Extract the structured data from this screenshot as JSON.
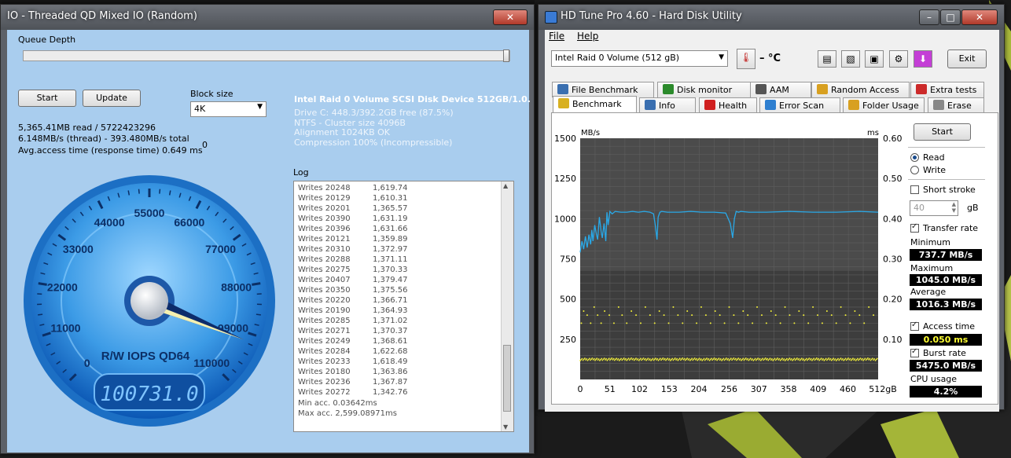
{
  "io": {
    "title": "IO - Threaded QD Mixed IO (Random)",
    "queue_depth_label": "Queue Depth",
    "start_label": "Start",
    "update_label": "Update",
    "block_size_label": "Block size",
    "block_size_value": "4K",
    "stat_line1": "5,365.41MB read / 5722423296",
    "stat_line2": "6.148MB/s (thread) - 393.480MB/s total",
    "stat_line3": "Avg.access time (response time) 0.649 ms",
    "zero_value": "0",
    "disk_title": "Intel Raid 0 Volume SCSI Disk Device 512GB/1.0.",
    "disk_info": [
      "Drive C: 448.3/392.2GB free (87.5%)",
      "NTFS - Cluster size 4096B",
      "Alignment 1024KB OK",
      "Compression 100% (Incompressible)"
    ],
    "log_label": "Log",
    "log_rows": [
      {
        "name": "Writes 20248",
        "value": "1,619.74"
      },
      {
        "name": "Writes 20129",
        "value": "1,610.31"
      },
      {
        "name": "Writes 20201",
        "value": "1,365.57"
      },
      {
        "name": "Writes 20390",
        "value": "1,631.19"
      },
      {
        "name": "Writes 20396",
        "value": "1,631.66"
      },
      {
        "name": "Writes 20121",
        "value": "1,359.89"
      },
      {
        "name": "Writes 20310",
        "value": "1,372.97"
      },
      {
        "name": "Writes 20288",
        "value": "1,371.11"
      },
      {
        "name": "Writes 20275",
        "value": "1,370.33"
      },
      {
        "name": "Writes 20407",
        "value": "1,379.47"
      },
      {
        "name": "Writes 20350",
        "value": "1,375.56"
      },
      {
        "name": "Writes 20220",
        "value": "1,366.71"
      },
      {
        "name": "Writes 20190",
        "value": "1,364.93"
      },
      {
        "name": "Writes 20285",
        "value": "1,371.02"
      },
      {
        "name": "Writes 20271",
        "value": "1,370.37"
      },
      {
        "name": "Writes 20249",
        "value": "1,368.61"
      },
      {
        "name": "Writes 20284",
        "value": "1,622.68"
      },
      {
        "name": "Writes 20233",
        "value": "1,618.49"
      },
      {
        "name": "Writes 20180",
        "value": "1,363.86"
      },
      {
        "name": "Writes 20236",
        "value": "1,367.87"
      },
      {
        "name": "Writes 20272",
        "value": "1,342.76"
      }
    ],
    "log_min": "Min acc. 0.03642ms",
    "log_max": "Max acc. 2,599.08971ms",
    "gauge_label": "R/W IOPS QD64",
    "gauge_value": "100731.0",
    "gauge_ticks": [
      "0",
      "11000",
      "22000",
      "33000",
      "44000",
      "55000",
      "66000",
      "77000",
      "88000",
      "99000",
      "110000"
    ],
    "gauge_fraction": 0.916
  },
  "hd": {
    "title": "HD Tune Pro 4.60 - Hard Disk Utility",
    "menu": [
      "File",
      "Help"
    ],
    "drive": "Intel   Raid 0 Volume (512 gB)",
    "temp": "– °C",
    "exit_label": "Exit",
    "tabs_row1": [
      "File Benchmark",
      "Disk monitor",
      "AAM",
      "Random Access",
      "Extra tests"
    ],
    "tabs_row2": [
      "Benchmark",
      "Info",
      "Health",
      "Error Scan",
      "Folder Usage",
      "Erase"
    ],
    "start_label": "Start",
    "read_label": "Read",
    "write_label": "Write",
    "short_stroke_label": "Short stroke",
    "short_stroke_value": "40",
    "gb_label": "gB",
    "transfer_rate_label": "Transfer rate",
    "minimum_label": "Minimum",
    "minimum_value": "737.7 MB/s",
    "maximum_label": "Maximum",
    "maximum_value": "1045.0 MB/s",
    "average_label": "Average",
    "average_value": "1016.3 MB/s",
    "access_time_label": "Access time",
    "access_time_value": "0.050 ms",
    "burst_rate_label": "Burst rate",
    "burst_rate_value": "5475.0 MB/s",
    "cpu_label": "CPU usage",
    "cpu_value": "4.2%"
  },
  "colors": {
    "gauge_blue": "#1e73c8",
    "line_blue": "#29a9e8",
    "scatter_yellow": "#f2ef3a",
    "lcd_text": "#ffffff"
  },
  "chart_data": {
    "type": "line",
    "ylabel": "MB/s",
    "y2label": "ms",
    "ylim": [
      0,
      1500
    ],
    "y2lim": [
      0,
      0.6
    ],
    "yticks": [
      "250",
      "500",
      "750",
      "1000",
      "1250",
      "1500"
    ],
    "y2ticks": [
      "0.10",
      "0.20",
      "0.30",
      "0.40",
      "0.50",
      "0.60"
    ],
    "xticks": [
      "0",
      "51",
      "102",
      "153",
      "204",
      "256",
      "307",
      "358",
      "409",
      "460",
      "512gB"
    ],
    "xlim": [
      0,
      512
    ],
    "series": [
      {
        "values_x": [
          0,
          3,
          6,
          9,
          12,
          15,
          18,
          20,
          22,
          25,
          28,
          30,
          33,
          36,
          38,
          41,
          44,
          46,
          48,
          51,
          55,
          60,
          70,
          80,
          90,
          100,
          110,
          120,
          126,
          129,
          132,
          134,
          137,
          140,
          150,
          170,
          190,
          210,
          230,
          250,
          258,
          262,
          265,
          268,
          272,
          276,
          290,
          320,
          360,
          400,
          440,
          480,
          512
        ],
        "values_y": [
          790,
          860,
          810,
          890,
          820,
          900,
          840,
          930,
          860,
          960,
          900,
          870,
          1010,
          920,
          880,
          970,
          860,
          1040,
          960,
          1045,
          1030,
          1045,
          1040,
          1040,
          1045,
          1040,
          1045,
          1040,
          1030,
          960,
          870,
          1010,
          1040,
          1045,
          1040,
          1040,
          1045,
          1040,
          1040,
          1035,
          970,
          880,
          1000,
          1045,
          1040,
          1045,
          1040,
          1040,
          1045,
          1040,
          1040,
          1045,
          1040
        ]
      },
      {
        "type": "scatter",
        "note_x_y": "access time ms",
        "values_x": [
          2,
          6,
          12,
          18,
          24,
          30,
          36,
          42,
          50,
          58,
          66,
          72,
          80,
          88,
          96,
          104,
          112,
          120,
          128,
          136,
          144,
          152,
          160,
          168,
          176,
          184,
          192,
          200,
          208,
          216,
          224,
          232,
          240,
          248,
          256,
          264,
          272,
          280,
          288,
          296,
          304,
          312,
          320,
          328,
          336,
          344,
          352,
          360,
          368,
          376,
          384,
          392,
          400,
          408,
          416,
          424,
          432,
          440,
          448,
          456,
          464,
          472,
          480,
          488,
          496,
          504
        ],
        "values_y": [
          0.14,
          0.17,
          0.16,
          0.14,
          0.18,
          0.16,
          0.14,
          0.17,
          0.16,
          0.14,
          0.18,
          0.16,
          0.14,
          0.17,
          0.16,
          0.14,
          0.18,
          0.16,
          0.14,
          0.17,
          0.16,
          0.14,
          0.18,
          0.16,
          0.14,
          0.17,
          0.16,
          0.14,
          0.18,
          0.16,
          0.14,
          0.17,
          0.16,
          0.14,
          0.18,
          0.16,
          0.14,
          0.17,
          0.16,
          0.14,
          0.18,
          0.16,
          0.14,
          0.17,
          0.16,
          0.14,
          0.18,
          0.16,
          0.14,
          0.17,
          0.16,
          0.14,
          0.18,
          0.16,
          0.14,
          0.17,
          0.16,
          0.14,
          0.18,
          0.16,
          0.14,
          0.17,
          0.16,
          0.14,
          0.18,
          0.16
        ]
      },
      {
        "type": "band",
        "value": 0.05
      }
    ]
  }
}
